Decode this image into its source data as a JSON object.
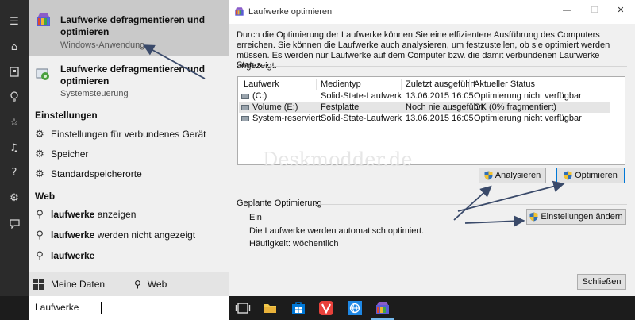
{
  "start_menu": {
    "best_match": {
      "title": "Laufwerke defragmentieren und optimieren",
      "subtitle": "Windows-Anwendung"
    },
    "second_result": {
      "title": "Laufwerke defragmentieren und optimieren",
      "subtitle": "Systemsteuerung"
    },
    "settings_header": "Einstellungen",
    "settings_items": [
      "Einstellungen für verbundenes Gerät",
      "Speicher",
      "Standardspeicherorte"
    ],
    "web_header": "Web",
    "web_items": [
      {
        "bold": "laufwerke",
        "rest": " anzeigen"
      },
      {
        "bold": "laufwerke",
        "rest": " werden nicht angezeigt"
      },
      {
        "bold": "laufwerke",
        "rest": ""
      }
    ],
    "footer": {
      "my_data": "Meine Daten",
      "web": "Web"
    },
    "rail_icons": [
      "hamburger-icon",
      "home-icon",
      "notebook-icon",
      "lightbulb-icon",
      "star-icon",
      "music-icon",
      "help-icon",
      "gear-icon",
      "feedback-icon"
    ]
  },
  "taskbar": {
    "search_text": "Laufwerke"
  },
  "dialog": {
    "title": "Laufwerke optimieren",
    "caption": {
      "minimize": "—",
      "maximize": "☐",
      "close": "✕"
    },
    "description": "Durch die Optimierung der Laufwerke können Sie eine effizientere Ausführung des Computers erreichen. Sie können die Laufwerke auch analysieren, um festzustellen, ob sie optimiert werden müssen. Es werden nur Laufwerke auf dem Computer bzw. die damit verbundenen Laufwerke angezeigt.",
    "status_label": "Status",
    "columns": [
      "Laufwerk",
      "Medientyp",
      "Zuletzt ausgeführt",
      "Aktueller Status"
    ],
    "rows": [
      {
        "drive": "(C:)",
        "media": "Solid-State-Laufwerk",
        "last_run": "13.06.2015 16:05",
        "status": "Optimierung nicht verfügbar"
      },
      {
        "drive": "Volume (E:)",
        "media": "Festplatte",
        "last_run": "Noch nie ausgeführt",
        "status": "OK (0% fragmentiert)"
      },
      {
        "drive": "System-reserviert",
        "media": "Solid-State-Laufwerk",
        "last_run": "13.06.2015 16:05",
        "status": "Optimierung nicht verfügbar"
      }
    ],
    "watermark": "Deskmodder.de",
    "buttons": {
      "analyze": "Analysieren",
      "optimize": "Optimieren",
      "change_settings": "Einstellungen ändern",
      "close": "Schließen"
    },
    "scheduled_label": "Geplante Optimierung",
    "scheduled_state": "Ein",
    "scheduled_desc": "Die Laufwerke werden automatisch optimiert.",
    "frequency": "Häufigkeit: wöchentlich"
  },
  "colors": {
    "selection": "#c9c9c9",
    "accent": "#0078d7",
    "arrow": "#3a4a6a"
  }
}
